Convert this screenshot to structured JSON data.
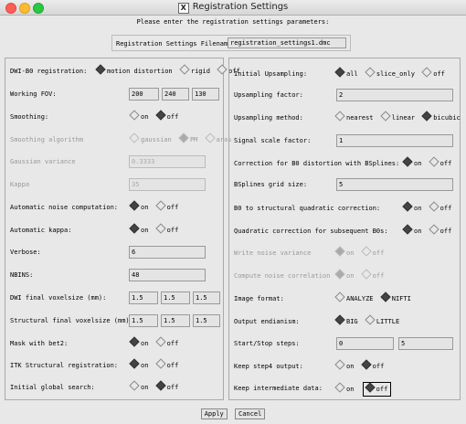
{
  "window": {
    "title": "Registration Settings"
  },
  "prompt": "Please enter the registration settings parameters:",
  "filename": {
    "label": "Registration Settings Filename:",
    "value": "registration_settings1.dmc"
  },
  "left": {
    "dwi_reg": {
      "label": "DWI-B0 registration:",
      "options": [
        "motion distortion",
        "rigid",
        "off"
      ]
    },
    "fov": {
      "label": "Working FOV:",
      "values": [
        "200",
        "240",
        "130"
      ]
    },
    "smoothing": {
      "label": "Smoothing:",
      "options": [
        "on",
        "off"
      ]
    },
    "smooth_alg": {
      "label": "Smoothing algorithm",
      "options": [
        "gaussian",
        "PM",
        "aras"
      ]
    },
    "gauss_var": {
      "label": "Gaussian variance",
      "value": "0.3333"
    },
    "kappa": {
      "label": "Kappa",
      "value": "35"
    },
    "auto_noise": {
      "label": "Automatic noise computation:",
      "options": [
        "on",
        "off"
      ]
    },
    "auto_kappa": {
      "label": "Automatic kappa:",
      "options": [
        "on",
        "off"
      ]
    },
    "verbose": {
      "label": "Verbose:",
      "value": "6"
    },
    "nbins": {
      "label": "NBINS:",
      "value": "48"
    },
    "dwi_vox": {
      "label": "DWI final voxelsize (mm):",
      "values": [
        "1.5",
        "1.5",
        "1.5"
      ]
    },
    "struct_vox": {
      "label": "Structural final voxelsize (mm):",
      "values": [
        "1.5",
        "1.5",
        "1.5"
      ]
    },
    "mask": {
      "label": "Mask with bet2:",
      "options": [
        "on",
        "off"
      ]
    },
    "itk": {
      "label": "ITK Structural registration:",
      "options": [
        "on",
        "off"
      ]
    },
    "global": {
      "label": "Initial global search:",
      "options": [
        "on",
        "off"
      ]
    }
  },
  "right": {
    "ups": {
      "label": "Initial Upsampling:",
      "options": [
        "all",
        "slice_only",
        "off"
      ]
    },
    "ups_factor": {
      "label": "Upsampling factor:",
      "value": "2"
    },
    "ups_method": {
      "label": "Upsampling method:",
      "options": [
        "nearest",
        "linear",
        "bicubic"
      ]
    },
    "scale": {
      "label": "Signal scale factor:",
      "value": "1"
    },
    "b0corr": {
      "label": "Correction for B0 distortion with BSplines:",
      "options": [
        "on",
        "off"
      ]
    },
    "grid": {
      "label": "BSplines grid size:",
      "value": "5"
    },
    "b0quad": {
      "label": "B0 to structural quadratic correction:",
      "options": [
        "on",
        "off"
      ]
    },
    "quad_sub": {
      "label": "Quadratic correction for subsequent B0s:",
      "options": [
        "on",
        "off"
      ]
    },
    "write_noise": {
      "label": "Write noise variance",
      "options": [
        "on",
        "off"
      ]
    },
    "noise_corr": {
      "label": "Compute noise correlation",
      "options": [
        "on",
        "off"
      ]
    },
    "img_fmt": {
      "label": "Image format:",
      "options": [
        "ANALYZE",
        "NIFTI"
      ]
    },
    "endian": {
      "label": "Output endianism:",
      "options": [
        "BIG",
        "LITTLE"
      ]
    },
    "steps": {
      "label": "Start/Stop steps:",
      "values": [
        "0",
        "5"
      ]
    },
    "step4": {
      "label": "Keep step4 output:",
      "options": [
        "on",
        "off"
      ]
    },
    "inter": {
      "label": "Keep intermediate data:",
      "options": [
        "on",
        "off"
      ]
    }
  },
  "buttons": {
    "apply": "Apply",
    "cancel": "Cancel"
  }
}
